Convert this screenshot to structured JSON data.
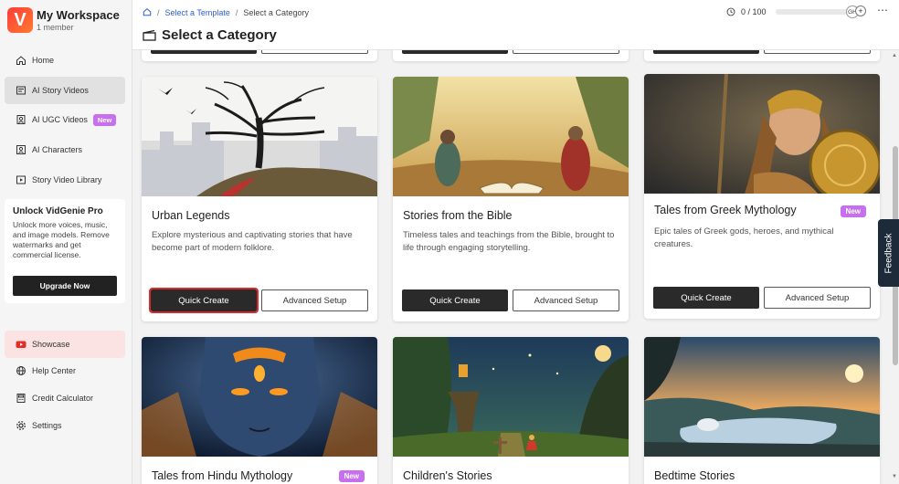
{
  "workspace": {
    "logo_letter": "V",
    "name": "My Workspace",
    "members": "1 member"
  },
  "sidebar": {
    "items": [
      {
        "label": "Home",
        "icon": "home-icon"
      },
      {
        "label": "AI Story Videos",
        "icon": "story-icon"
      },
      {
        "label": "AI UGC Videos",
        "icon": "ugc-icon",
        "badge": "New"
      },
      {
        "label": "AI Characters",
        "icon": "characters-icon"
      },
      {
        "label": "Story Video Library",
        "icon": "library-icon"
      }
    ],
    "bottom_items": [
      {
        "label": "Showcase",
        "icon": "youtube-icon"
      },
      {
        "label": "Help Center",
        "icon": "globe-icon"
      },
      {
        "label": "Credit Calculator",
        "icon": "calculator-icon"
      },
      {
        "label": "Settings",
        "icon": "gear-icon"
      }
    ]
  },
  "promo": {
    "title": "Unlock VidGenie Pro",
    "text": "Unlock more voices, music, and image models. Remove watermarks and get commercial license.",
    "button": "Upgrade Now"
  },
  "header": {
    "breadcrumb": [
      "Select a Template",
      "Select a Category"
    ],
    "title": "Select a Category",
    "credits": "0 / 100",
    "avatar": "GH"
  },
  "cards": [
    {
      "title": "Urban Legends",
      "desc": "Explore mysterious and captivating stories that have become part of modern folklore.",
      "quick": "Quick Create",
      "advanced": "Advanced Setup"
    },
    {
      "title": "Stories from the Bible",
      "desc": "Timeless tales and teachings from the Bible, brought to life through engaging storytelling.",
      "quick": "Quick Create",
      "advanced": "Advanced Setup"
    },
    {
      "title": "Tales from Greek Mythology",
      "badge": "New",
      "desc": "Epic tales of Greek gods, heroes, and mythical creatures.",
      "quick": "Quick Create",
      "advanced": "Advanced Setup"
    },
    {
      "title": "Tales from Hindu Mythology",
      "badge": "New"
    },
    {
      "title": "Children's Stories"
    },
    {
      "title": "Bedtime Stories"
    }
  ],
  "feedback": "Feedback",
  "colors": {
    "accent_new": "#c86ff0",
    "primary_button": "#2a2a2a",
    "link": "#2e5fd6"
  }
}
